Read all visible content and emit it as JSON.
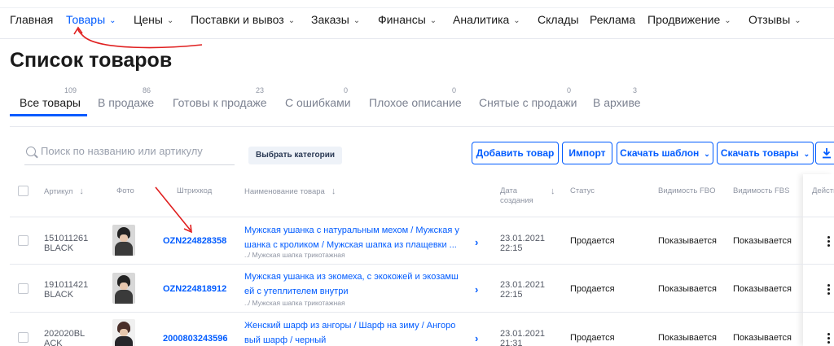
{
  "nav": {
    "items": [
      {
        "label": "Главная",
        "dropdown": false
      },
      {
        "label": "Товары",
        "dropdown": true,
        "active": true
      },
      {
        "label": "Цены",
        "dropdown": true
      },
      {
        "label": "Поставки и вывоз",
        "dropdown": true
      },
      {
        "label": "Заказы",
        "dropdown": true
      },
      {
        "label": "Финансы",
        "dropdown": true
      },
      {
        "label": "Аналитика",
        "dropdown": true
      },
      {
        "label": "Склады",
        "dropdown": false
      },
      {
        "label": "Реклама",
        "dropdown": false
      },
      {
        "label": "Продвижение",
        "dropdown": true
      },
      {
        "label": "Отзывы",
        "dropdown": true
      }
    ]
  },
  "page": {
    "title": "Список товаров"
  },
  "tabs": [
    {
      "label": "Все товары",
      "count": "109",
      "active": true
    },
    {
      "label": "В продаже",
      "count": "86"
    },
    {
      "label": "Готовы к продаже",
      "count": "23"
    },
    {
      "label": "С ошибками",
      "count": "0"
    },
    {
      "label": "Плохое описание",
      "count": "0"
    },
    {
      "label": "Снятые с продажи",
      "count": "0"
    },
    {
      "label": "В архиве",
      "count": "3"
    }
  ],
  "toolbar": {
    "search_placeholder": "Поиск по названию или артикулу",
    "category_button": "Выбрать категории",
    "add_button": "Добавить товар",
    "import_button": "Импорт",
    "template_button": "Скачать шаблон",
    "download_button": "Скачать товары"
  },
  "table": {
    "headers": {
      "sku": "Артикул",
      "photo": "Фото",
      "barcode": "Штрихкод",
      "name": "Наименование товара",
      "date_line1": "Дата",
      "date_line2": "создания",
      "status": "Статус",
      "fbo": "Видимость FBO",
      "fbs": "Видимость FBS",
      "actions": "Действия"
    },
    "rows": [
      {
        "sku_line1": "151011261",
        "sku_line2": "BLACK",
        "barcode": "OZN224828358",
        "name_line1": "Мужская ушанка с натуральным мехом / Мужская у",
        "name_line2": "шанка с кроликом / Мужская шапка из плащевки ...",
        "category": "../ Мужская шапка трикотажная",
        "date_line1": "23.01.2021",
        "date_line2": "22:15",
        "status": "Продается",
        "fbo": "Показывается",
        "fbs": "Показывается"
      },
      {
        "sku_line1": "191011421",
        "sku_line2": "BLACK",
        "barcode": "OZN224818912",
        "name_line1": "Мужская ушанка из экомеха, с экокожей и экозамш",
        "name_line2": "ей с утеплителем внутри",
        "category": "../ Мужская шапка трикотажная",
        "date_line1": "23.01.2021",
        "date_line2": "22:15",
        "status": "Продается",
        "fbo": "Показывается",
        "fbs": "Показывается"
      },
      {
        "sku_line1": "202020BL",
        "sku_line2": "ACK",
        "barcode": "2000803243596",
        "name_line1": "Женский шарф из ангоры / Шарф на зиму / Ангоро",
        "name_line2": "вый шарф / черный",
        "category": "",
        "date_line1": "23.01.2021",
        "date_line2": "21:31",
        "status": "Продается",
        "fbo": "Показывается",
        "fbs": "Показывается"
      }
    ]
  },
  "colors": {
    "accent": "#005bff",
    "annotation": "#e02020"
  }
}
